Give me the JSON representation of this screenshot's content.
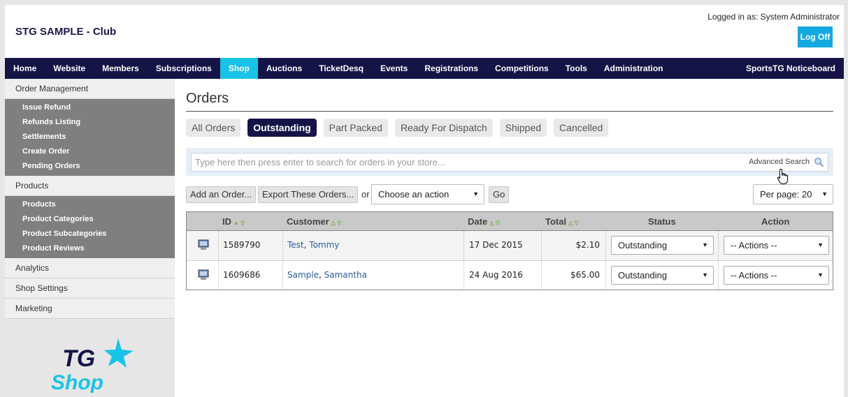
{
  "header": {
    "club_title": "STG SAMPLE - Club",
    "login_info": "Logged in as: System Administrator",
    "logoff_label": "Log Off"
  },
  "nav": {
    "items": [
      "Home",
      "Website",
      "Members",
      "Subscriptions",
      "Shop",
      "Auctions",
      "TicketDesq",
      "Events",
      "Registrations",
      "Competitions",
      "Tools",
      "Administration"
    ],
    "active": "Shop",
    "right_label": "SportsTG Noticeboard"
  },
  "sidebar": {
    "order_management": "Order Management",
    "order_items": [
      "Issue Refund",
      "Refunds Listing",
      "Settlements",
      "Create Order",
      "Pending Orders"
    ],
    "products": "Products",
    "product_items": [
      "Products",
      "Product Categories",
      "Product Subcategories",
      "Product Reviews"
    ],
    "analytics": "Analytics",
    "shop_settings": "Shop Settings",
    "marketing": "Marketing",
    "logo_top": "TG",
    "logo_bottom": "Shop"
  },
  "main": {
    "title": "Orders",
    "tabs": [
      "All Orders",
      "Outstanding",
      "Part Packed",
      "Ready For Dispatch",
      "Shipped",
      "Cancelled"
    ],
    "active_tab": "Outstanding",
    "search_placeholder": "Type here then press enter to search for orders in your store...",
    "advanced_search": "Advanced Search",
    "add_order": "Add an Order...",
    "export_orders": "Export These Orders...",
    "or_label": "or",
    "action_select": "Choose an action",
    "go": "Go",
    "per_page": "Per page: 20"
  },
  "table": {
    "headers": {
      "id": "ID",
      "customer": "Customer",
      "date": "Date",
      "total": "Total",
      "status": "Status",
      "action": "Action"
    },
    "rows": [
      {
        "id": "1589790",
        "first": "Test",
        "last": "Tommy",
        "date": "17 Dec 2015",
        "total": "$2.10",
        "status": "Outstanding",
        "action": "-- Actions --"
      },
      {
        "id": "1609686",
        "first": "Sample",
        "last": "Samantha",
        "date": "24 Aug 2016",
        "total": "$65.00",
        "status": "Outstanding",
        "action": "-- Actions --"
      }
    ]
  },
  "colors": {
    "nav_bg": "#141447",
    "accent": "#19c3e6",
    "logoff": "#14a8e0"
  }
}
